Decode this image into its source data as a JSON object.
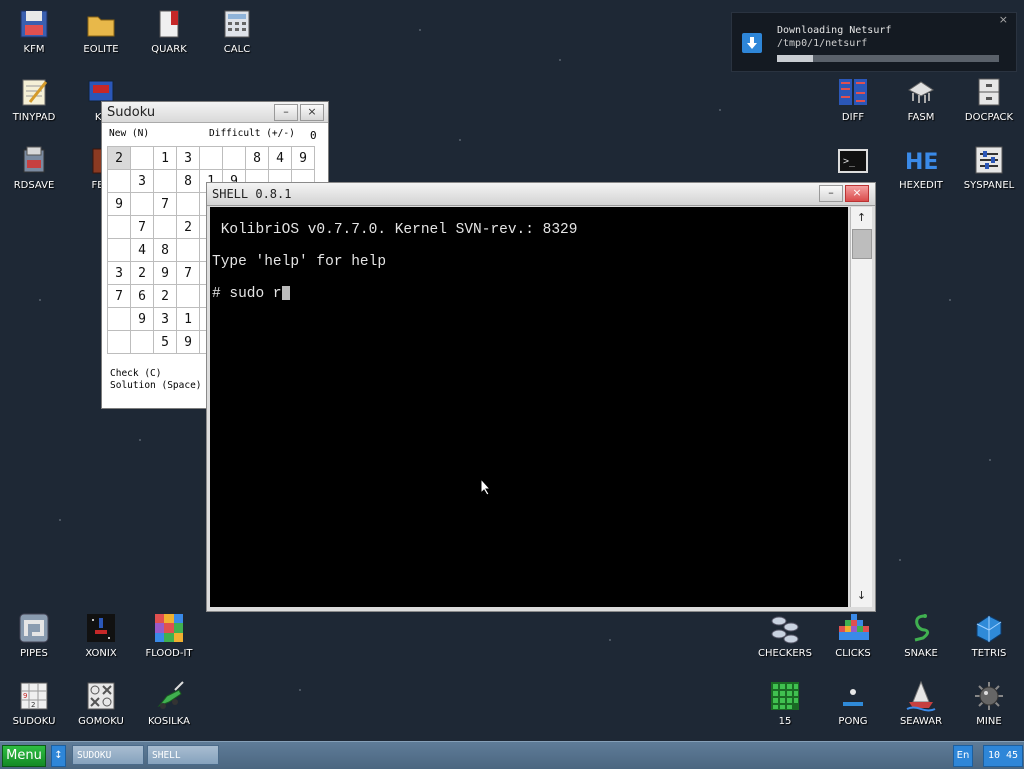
{
  "desktop_icons": [
    {
      "label": "KFM",
      "icon": "floppy-icon"
    },
    {
      "label": "EOLITE",
      "icon": "folder-icon"
    },
    {
      "label": "QUARK",
      "icon": "red-book-icon"
    },
    {
      "label": "CALC",
      "icon": "calculator-icon"
    },
    {
      "label": "TINYPAD",
      "icon": "notepad-icon"
    },
    {
      "label": "KF",
      "icon": "monitor-icon"
    },
    {
      "label": "RDSAVE",
      "icon": "save-icon"
    },
    {
      "label": "FB2",
      "icon": "book-icon"
    },
    {
      "label": "DIFF",
      "icon": "diff-icon"
    },
    {
      "label": "FASM",
      "icon": "fasm-icon"
    },
    {
      "label": "DOCPACK",
      "icon": "cabinet-icon"
    },
    {
      "label": "HEXEDIT",
      "icon": "hex-icon"
    },
    {
      "label": "SYSPANEL",
      "icon": "sliders-icon"
    },
    {
      "label": "PIPES",
      "icon": "pipes-icon"
    },
    {
      "label": "XONIX",
      "icon": "xonix-icon"
    },
    {
      "label": "FLOOD-IT",
      "icon": "flood-icon"
    },
    {
      "label": "SUDOKU",
      "icon": "sudoku-icon"
    },
    {
      "label": "GOMOKU",
      "icon": "gomoku-icon"
    },
    {
      "label": "KOSILKA",
      "icon": "lawnmower-icon"
    },
    {
      "label": "CHECKERS",
      "icon": "checkers-icon"
    },
    {
      "label": "CLICKS",
      "icon": "clicks-icon"
    },
    {
      "label": "SNAKE",
      "icon": "snake-icon"
    },
    {
      "label": "TETRIS",
      "icon": "tetris-icon"
    },
    {
      "label": "15",
      "icon": "fifteen-icon"
    },
    {
      "label": "PONG",
      "icon": "pong-icon"
    },
    {
      "label": "SEAWAR",
      "icon": "ship-icon"
    },
    {
      "label": "MINE",
      "icon": "mine-icon"
    }
  ],
  "notification": {
    "title": "Downloading Netsurf",
    "path": "/tmp0/1/netsurf",
    "progress": 0.16,
    "close": "×"
  },
  "sudoku": {
    "title": "Sudoku",
    "new_label": "New (N)",
    "difficulty_label": "Difficult (+/-)",
    "level": "0",
    "check_label": "Check (C)",
    "solution_label": "Solution (Space)",
    "rows": [
      [
        "2",
        "",
        "1",
        "3",
        "",
        "",
        "8",
        "4",
        "9"
      ],
      [
        "",
        "3",
        "",
        "8",
        "1",
        "9",
        "",
        "",
        ""
      ],
      [
        "9",
        "",
        "7",
        "",
        "",
        "",
        "",
        "",
        ""
      ],
      [
        "",
        "7",
        "",
        "2",
        "",
        "",
        "",
        "",
        ""
      ],
      [
        "",
        "4",
        "8",
        "",
        "",
        "",
        "",
        "",
        ""
      ],
      [
        "3",
        "2",
        "9",
        "7",
        "",
        "",
        "",
        "",
        ""
      ],
      [
        "7",
        "6",
        "2",
        "",
        "",
        "",
        "",
        "",
        ""
      ],
      [
        "",
        "9",
        "3",
        "1",
        "",
        "",
        "",
        "",
        ""
      ],
      [
        "",
        "",
        "5",
        "9",
        "",
        "",
        "",
        "",
        ""
      ]
    ]
  },
  "shell": {
    "title": "SHELL 0.8.1",
    "lines": [
      " KolibriOS v0.7.7.0. Kernel SVN-rev.: 8329",
      "Type 'help' for help",
      "# sudo r"
    ],
    "minimize": "–",
    "close": "×"
  },
  "window_buttons": {
    "minimize": "–",
    "close": "×"
  },
  "taskbar": {
    "menu_label": "Menu",
    "switch_label": "↕",
    "tasks": [
      "SUDOKU",
      "SHELL"
    ],
    "lang": "En",
    "clock": "10 45"
  },
  "colors": {
    "desktop_bg": "#1e2835",
    "taskbar": "#5f7c98",
    "menu_button": "#1fa336",
    "accent_blue": "#2e86d8"
  }
}
